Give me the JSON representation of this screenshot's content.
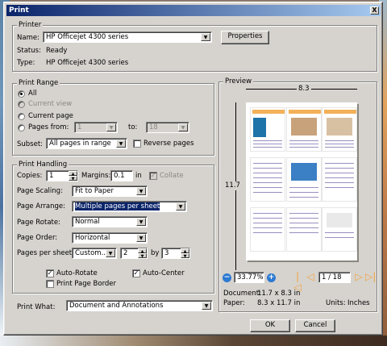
{
  "window": {
    "title": "Print",
    "close": "X"
  },
  "printer": {
    "group": "Printer",
    "name_label": "Name:",
    "name_value": "HP Officejet 4300 series",
    "properties_button": "Properties",
    "status_label": "Status:",
    "status_value": "Ready",
    "type_label": "Type:",
    "type_value": "HP Officejet 4300 series"
  },
  "range": {
    "group": "Print Range",
    "all": "All",
    "current_view": "Current view",
    "current_page": "Current page",
    "pages_from": "Pages from:",
    "from_value": "1",
    "to_label": "to:",
    "to_value": "18",
    "subset_label": "Subset:",
    "subset_value": "All pages in range",
    "reverse_pages": "Reverse pages",
    "selected": "All"
  },
  "handling": {
    "group": "Print Handling",
    "copies_label": "Copies:",
    "copies_value": "1",
    "margins_label": "Margins:",
    "margins_value": "0.1",
    "margins_unit": "in",
    "collate": "Collate",
    "scaling_label": "Page Scaling:",
    "scaling_value": "Fit to Paper",
    "arrange_label": "Page Arrange:",
    "arrange_value": "Multiple pages per sheet",
    "rotate_label": "Page Rotate:",
    "rotate_value": "Normal",
    "order_label": "Page Order:",
    "order_value": "Horizontal",
    "pps_label": "Pages per sheet:",
    "pps_value": "Custom...",
    "cols_value": "2",
    "by_label": "by",
    "rows_value": "3",
    "auto_rotate": "Auto-Rotate",
    "auto_center": "Auto-Center",
    "print_border": "Print Page Border",
    "auto_rotate_checked": true,
    "auto_center_checked": true,
    "print_border_checked": false,
    "collate_checked": true,
    "reverse_checked": false
  },
  "print_what": {
    "label": "Print What:",
    "value": "Document and Annotations"
  },
  "preview": {
    "group": "Preview",
    "width_label": "8.3",
    "height_label": "11.7",
    "zoom_value": "33.77%",
    "page_value": "1 / 18",
    "document_label": "Document:",
    "document_size": "11.7 x 8.3 in",
    "paper_label": "Paper:",
    "paper_size": "8.3 x 11.7 in",
    "units_label": "Units:",
    "units_value": "Inches"
  },
  "buttons": {
    "ok": "OK",
    "cancel": "Cancel"
  }
}
